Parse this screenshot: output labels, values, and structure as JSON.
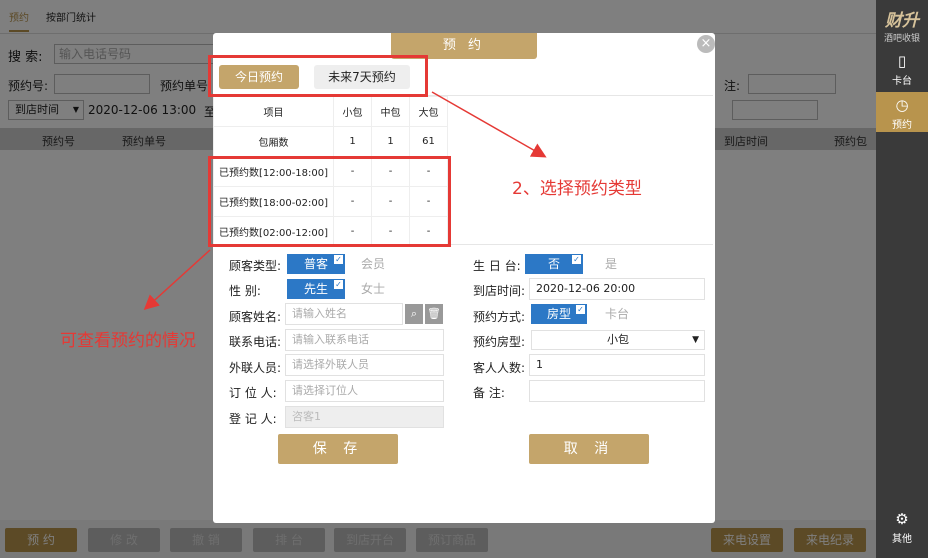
{
  "top_tabs": [
    "预约",
    "按部门统计"
  ],
  "search": {
    "label": "搜  索:",
    "placeholder": "输入电话号码"
  },
  "filters": {
    "reservation_no_label": "预约号:",
    "reservation_single_label": "预约单号",
    "note_label": "注:",
    "time_type": "到店时间",
    "start_time": "2020-12-06 13:00",
    "to_label": "至"
  },
  "table_headers": [
    "预约号",
    "预约单号",
    "到店时间",
    "预约包厢"
  ],
  "bottom_buttons": [
    "预 约",
    "修 改",
    "撤 销",
    "排 台",
    "到店开台",
    "预订商品"
  ],
  "bottom_right_buttons": [
    "来电设置",
    "来电纪录"
  ],
  "sidebar": {
    "logo_main": "财升",
    "logo_sub": "酒吧收银",
    "items": [
      {
        "label": "卡台",
        "icon": "door-icon"
      },
      {
        "label": "预约",
        "icon": "clock-icon"
      }
    ],
    "bottom": {
      "label": "其他",
      "icon": "gear-icon"
    }
  },
  "modal": {
    "title": "预 约",
    "close": "×",
    "type_tabs": [
      "今日预约",
      "未来7天预约"
    ],
    "stats": {
      "headers": [
        "项目",
        "小包",
        "中包",
        "大包"
      ],
      "rows": [
        [
          "包厢数",
          "1",
          "1",
          "61"
        ],
        [
          "已预约数[12:00-18:00]",
          "-",
          "-",
          "-"
        ],
        [
          "已预约数[18:00-02:00]",
          "-",
          "-",
          "-"
        ],
        [
          "已预约数[02:00-12:00]",
          "-",
          "-",
          "-"
        ]
      ]
    },
    "form": {
      "customer_type_label": "顾客类型:",
      "customer_type_options": [
        "普客",
        "会员"
      ],
      "gender_label": "性    别:",
      "gender_options": [
        "先生",
        "女士"
      ],
      "name_label": "顾客姓名:",
      "name_placeholder": "请输入姓名",
      "phone_label": "联系电话:",
      "phone_placeholder": "请输入联系电话",
      "liaison_label": "外联人员:",
      "liaison_placeholder": "请选择外联人员",
      "booker_label": "订 位 人:",
      "booker_placeholder": "请选择订位人",
      "registrar_label": "登 记 人:",
      "registrar_value": "咨客1",
      "birthday_label": "生 日 台:",
      "birthday_options": [
        "否",
        "是"
      ],
      "arrival_label": "到店时间:",
      "arrival_value": "2020-12-06 20:00",
      "method_label": "预约方式:",
      "method_options": [
        "房型",
        "卡台"
      ],
      "room_type_label": "预约房型:",
      "room_type_value": "小包",
      "guests_label": "客人人数:",
      "guests_value": "1",
      "remark_label": "备    注:",
      "remark_value": ""
    },
    "save_label": "保 存",
    "cancel_label": "取 消"
  },
  "annotations": {
    "select_type": "2、选择预约类型",
    "view_status": "可查看预约的情况",
    "color": "#e53935"
  }
}
